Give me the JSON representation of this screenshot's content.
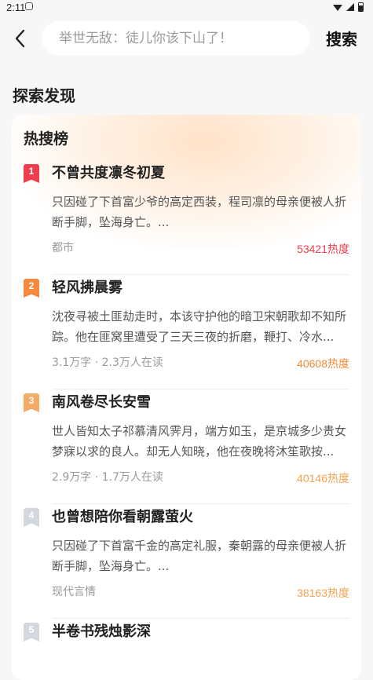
{
  "status_bar": {
    "time": "2:11"
  },
  "header": {
    "search_placeholder": "举世无敌：徒儿你该下山了！",
    "search_button": "搜索"
  },
  "section": {
    "title": "探索发现"
  },
  "hot_list": {
    "title": "热搜榜",
    "items": [
      {
        "rank": "1",
        "title": "不曾共度凛冬初夏",
        "desc": "只因碰了下首富少爷的高定西装，程司凛的母亲便被人折断手脚，坠海身亡。...",
        "meta": "都市",
        "heat": "53421热度"
      },
      {
        "rank": "2",
        "title": "轻风拂晨雾",
        "desc": "沈夜寻被土匪劫走时，本该守护他的暗卫宋朝歌却不知所踪。他在匪窝里遭受了三天三夜的折磨，鞭打、冷水...",
        "meta": "3.1万字 · 2.3万人在读",
        "heat": "40608热度"
      },
      {
        "rank": "3",
        "title": "南风卷尽长安雪",
        "desc": "世人皆知太子祁慕清风霁月，端方如玉，是京城多少贵女梦寐以求的良人。却无人知晓，他在夜晚将沐笙歌按...",
        "meta": "2.9万字 · 1.7万人在读",
        "heat": "40146热度"
      },
      {
        "rank": "4",
        "title": "也曾想陪你看朝露萤火",
        "desc": "只因碰了下首富千金的高定礼服，秦朝露的母亲便被人折断手脚，坠海身亡。...",
        "meta": "现代言情",
        "heat": "38163热度"
      },
      {
        "rank": "5",
        "title": "半卷书残烛影深",
        "desc": "",
        "meta": "",
        "heat": ""
      }
    ]
  }
}
